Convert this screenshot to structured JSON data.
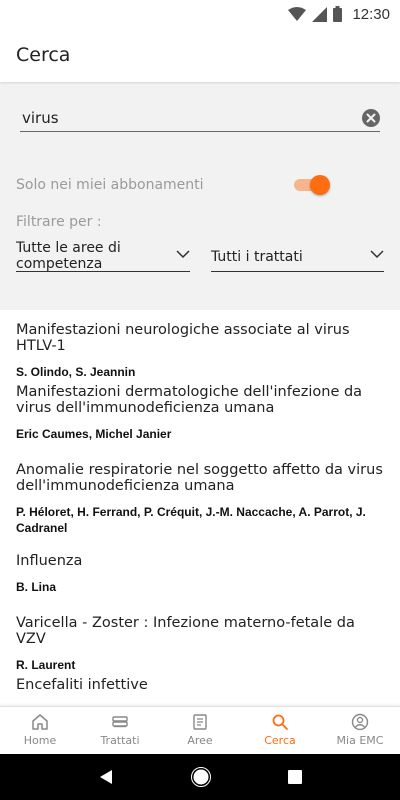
{
  "status_bar": {
    "time": "12:30"
  },
  "app_bar": {
    "title": "Cerca"
  },
  "search": {
    "value": "virus"
  },
  "toggle": {
    "label": "Solo nei miei abbonamenti",
    "on": true
  },
  "filters": {
    "label": "Filtrare per :",
    "areas_value": "Tutte le aree di competenza",
    "treatises_value": "Tutti i trattati"
  },
  "results": [
    {
      "title": "Manifestazioni neurologiche associate al virus HTLV-1",
      "authors": "S. Olindo, S. Jeannin"
    },
    {
      "title": "Manifestazioni dermatologiche dell'infezione da virus dell'immunodeficienza umana",
      "authors": "Eric Caumes, Michel Janier"
    },
    {
      "title": "Anomalie respiratorie nel soggetto affetto da virus dell'immunodeficienza umana",
      "authors": "P. Héloret, H. Ferrand, P. Créquit, J.-M. Naccache, A. Parrot, J. Cadranel"
    },
    {
      "title": "Influenza",
      "authors": "B. Lina"
    },
    {
      "title": "Varicella - Zoster : Infezione materno-fetale da VZV",
      "authors": "R. Laurent"
    },
    {
      "title": "Encefaliti infettive",
      "authors": ""
    }
  ],
  "bottom_nav": {
    "home": "Home",
    "trattati": "Trattati",
    "aree": "Aree",
    "cerca": "Cerca",
    "mia_emc": "Mia EMC",
    "active": "cerca"
  },
  "colors": {
    "accent": "#ff6c12",
    "panel_bg": "#f2f2f2",
    "muted_text": "#9a9a9a"
  }
}
